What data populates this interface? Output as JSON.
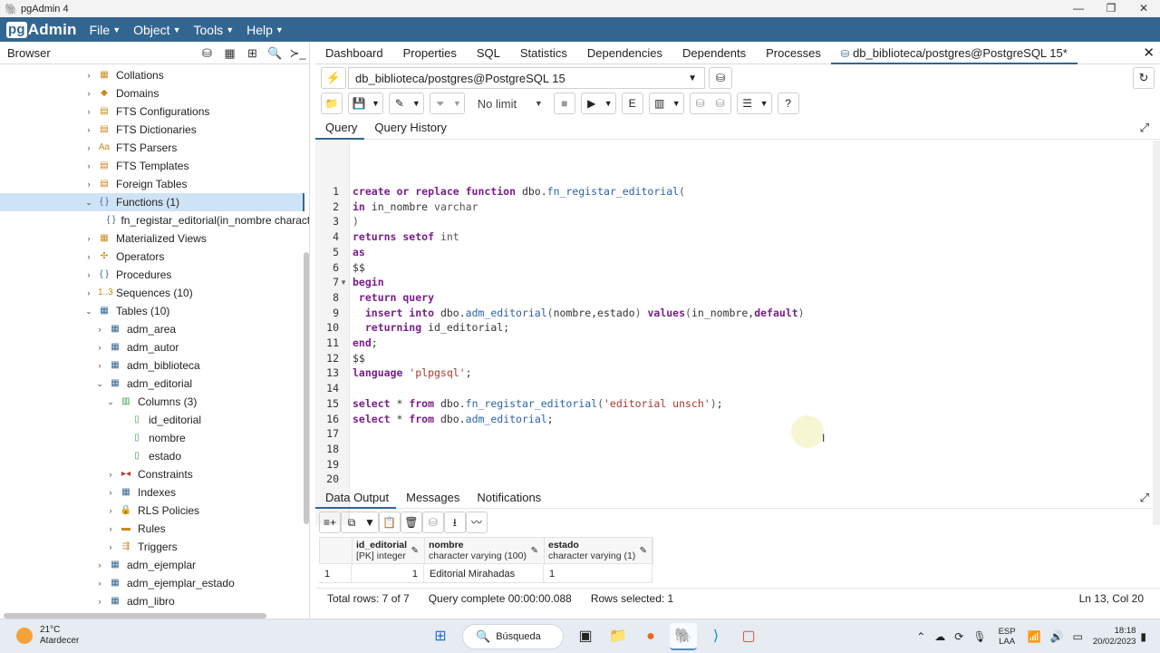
{
  "window": {
    "title": "pgAdmin 4",
    "minimize": "—",
    "maximize": "❐",
    "close": "✕"
  },
  "menubar": {
    "logo_pg": "pg",
    "logo_text": "Admin",
    "items": [
      {
        "label": "File"
      },
      {
        "label": "Object"
      },
      {
        "label": "Tools"
      },
      {
        "label": "Help"
      }
    ]
  },
  "browser": {
    "title": "Browser",
    "tree": [
      {
        "label": "Collations",
        "level": 1,
        "icon": "collation-icon",
        "glyph": "▦",
        "toggle": "›"
      },
      {
        "label": "Domains",
        "level": 1,
        "icon": "domain-icon",
        "glyph": "◆",
        "toggle": "›"
      },
      {
        "label": "FTS Configurations",
        "level": 1,
        "icon": "fts-config-icon",
        "glyph": "▤",
        "toggle": "›"
      },
      {
        "label": "FTS Dictionaries",
        "level": 1,
        "icon": "fts-dictionary-icon",
        "glyph": "▤",
        "toggle": "›"
      },
      {
        "label": "FTS Parsers",
        "level": 1,
        "icon": "fts-parser-icon",
        "glyph": "Aa",
        "toggle": "›"
      },
      {
        "label": "FTS Templates",
        "level": 1,
        "icon": "fts-template-icon",
        "glyph": "▤",
        "toggle": "›"
      },
      {
        "label": "Foreign Tables",
        "level": 1,
        "icon": "foreign-table-icon",
        "glyph": "▤",
        "toggle": "›"
      },
      {
        "label": "Functions (1)",
        "level": 1,
        "icon": "functions-icon",
        "glyph": "{ }",
        "toggle": "⌄",
        "selected": true
      },
      {
        "label": "fn_registar_editorial(in_nombre character",
        "level": 2,
        "icon": "function-icon",
        "glyph": "{ }",
        "toggle": ""
      },
      {
        "label": "Materialized Views",
        "level": 1,
        "icon": "materialized-view-icon",
        "glyph": "▦",
        "toggle": "›"
      },
      {
        "label": "Operators",
        "level": 1,
        "icon": "operator-icon",
        "glyph": "✣",
        "toggle": "›"
      },
      {
        "label": "Procedures",
        "level": 1,
        "icon": "procedure-icon",
        "glyph": "{ }",
        "toggle": "›"
      },
      {
        "label": "Sequences (10)",
        "level": 1,
        "icon": "sequence-icon",
        "glyph": "1..3",
        "toggle": "›"
      },
      {
        "label": "Tables (10)",
        "level": 1,
        "icon": "tables-icon",
        "glyph": "▦",
        "toggle": "⌄"
      },
      {
        "label": "adm_area",
        "level": 2,
        "icon": "table-icon",
        "glyph": "▦",
        "toggle": "›"
      },
      {
        "label": "adm_autor",
        "level": 2,
        "icon": "table-icon",
        "glyph": "▦",
        "toggle": "›"
      },
      {
        "label": "adm_biblioteca",
        "level": 2,
        "icon": "table-icon",
        "glyph": "▦",
        "toggle": "›"
      },
      {
        "label": "adm_editorial",
        "level": 2,
        "icon": "table-icon",
        "glyph": "▦",
        "toggle": "⌄"
      },
      {
        "label": "Columns (3)",
        "level": 3,
        "icon": "columns-icon",
        "glyph": "▥",
        "toggle": "⌄"
      },
      {
        "label": "id_editorial",
        "level": 4,
        "icon": "column-icon",
        "glyph": "▯",
        "toggle": ""
      },
      {
        "label": "nombre",
        "level": 4,
        "icon": "column-icon",
        "glyph": "▯",
        "toggle": ""
      },
      {
        "label": "estado",
        "level": 4,
        "icon": "column-icon",
        "glyph": "▯",
        "toggle": ""
      },
      {
        "label": "Constraints",
        "level": 3,
        "icon": "constraint-icon",
        "glyph": "▸◂",
        "toggle": "›"
      },
      {
        "label": "Indexes",
        "level": 3,
        "icon": "index-icon",
        "glyph": "▦",
        "toggle": "›"
      },
      {
        "label": "RLS Policies",
        "level": 3,
        "icon": "rls-policy-icon",
        "glyph": "🔒",
        "toggle": "›"
      },
      {
        "label": "Rules",
        "level": 3,
        "icon": "rule-icon",
        "glyph": "▬",
        "toggle": "›"
      },
      {
        "label": "Triggers",
        "level": 3,
        "icon": "trigger-icon",
        "glyph": "⇶",
        "toggle": "›"
      },
      {
        "label": "adm_ejemplar",
        "level": 2,
        "icon": "table-icon",
        "glyph": "▦",
        "toggle": "›"
      },
      {
        "label": "adm_ejemplar_estado",
        "level": 2,
        "icon": "table-icon",
        "glyph": "▦",
        "toggle": "›"
      },
      {
        "label": "adm_libro",
        "level": 2,
        "icon": "table-icon",
        "glyph": "▦",
        "toggle": "›"
      }
    ]
  },
  "main_tabs": [
    {
      "label": "Dashboard"
    },
    {
      "label": "Properties"
    },
    {
      "label": "SQL"
    },
    {
      "label": "Statistics"
    },
    {
      "label": "Dependencies"
    },
    {
      "label": "Dependents"
    },
    {
      "label": "Processes"
    },
    {
      "label": "db_biblioteca/postgres@PostgreSQL 15*",
      "active": true
    }
  ],
  "connection": {
    "value": "db_biblioteca/postgres@PostgreSQL 15"
  },
  "toolbar": {
    "limit": "No limit"
  },
  "query_tabs": [
    {
      "label": "Query",
      "active": true
    },
    {
      "label": "Query History"
    }
  ],
  "editor": {
    "lines": [
      [
        [
          "kw",
          "create or replace function "
        ],
        [
          "",
          "dbo."
        ],
        [
          "fnc",
          "fn_registar_editorial"
        ],
        [
          "ty",
          "("
        ]
      ],
      [
        [
          "kw",
          "in "
        ],
        [
          "",
          "in_nombre "
        ],
        [
          "ty",
          "varchar"
        ]
      ],
      [
        [
          "ty",
          ")"
        ]
      ],
      [
        [
          "kw",
          "returns setof "
        ],
        [
          "ty",
          "int"
        ]
      ],
      [
        [
          "kw",
          "as"
        ]
      ],
      [
        [
          "",
          "$$"
        ]
      ],
      [
        [
          "kw",
          "begin"
        ]
      ],
      [
        [
          "kw",
          " return query"
        ]
      ],
      [
        [
          "kw",
          "  insert into "
        ],
        [
          "",
          "dbo."
        ],
        [
          "fnc",
          "adm_editorial"
        ],
        [
          "ty",
          "("
        ],
        [
          "",
          "nombre,estado"
        ],
        [
          "ty",
          ") "
        ],
        [
          "kw",
          "values"
        ],
        [
          "ty",
          "("
        ],
        [
          "",
          "in_nombre,"
        ],
        [
          "kw",
          "default"
        ],
        [
          "ty",
          ")"
        ]
      ],
      [
        [
          "kw",
          "  returning "
        ],
        [
          "",
          "id_editorial;"
        ]
      ],
      [
        [
          "kw",
          "end"
        ],
        [
          "",
          ";"
        ]
      ],
      [
        [
          "",
          "$$"
        ]
      ],
      [
        [
          "kw",
          "language "
        ],
        [
          "str",
          "'plpgsql'"
        ],
        [
          "",
          ";"
        ]
      ],
      [],
      [
        [
          "kw",
          "select "
        ],
        [
          "",
          "* "
        ],
        [
          "kw",
          "from "
        ],
        [
          "",
          "dbo."
        ],
        [
          "fnc",
          "fn_registar_editorial"
        ],
        [
          "ty",
          "("
        ],
        [
          "str",
          "'editorial unsch'"
        ],
        [
          "ty",
          ")"
        ],
        [
          "",
          ";"
        ]
      ],
      [
        [
          "kw",
          "select "
        ],
        [
          "",
          "* "
        ],
        [
          "kw",
          "from "
        ],
        [
          "",
          "dbo."
        ],
        [
          "fnc",
          "adm_editorial"
        ],
        [
          "",
          ";"
        ]
      ],
      [],
      [],
      [],
      []
    ],
    "line_numbers": [
      "1",
      "2",
      "3",
      "4",
      "5",
      "6",
      "7",
      "8",
      "9",
      "10",
      "11",
      "12",
      "13",
      "14",
      "15",
      "16",
      "17",
      "18",
      "19",
      "20"
    ]
  },
  "result_tabs": [
    {
      "label": "Data Output",
      "active": true
    },
    {
      "label": "Messages"
    },
    {
      "label": "Notifications"
    }
  ],
  "grid": {
    "columns": [
      {
        "name": "id_editorial",
        "type": "[PK] integer"
      },
      {
        "name": "nombre",
        "type": "character varying (100)"
      },
      {
        "name": "estado",
        "type": "character varying (1)"
      }
    ],
    "rows": [
      {
        "num": "1",
        "cells": [
          "1",
          "Editorial Mirahadas",
          "1"
        ]
      }
    ]
  },
  "status": {
    "total_rows": "Total rows: 7 of 7",
    "query_complete": "Query complete 00:00:00.088",
    "rows_selected": "Rows selected: 1",
    "cursor_pos": "Ln 13, Col 20"
  },
  "taskbar": {
    "temperature": "21°C",
    "weather": "Atardecer",
    "search_label": "Búsqueda",
    "lang_top": "ESP",
    "lang_bottom": "LAA",
    "time": "18:18",
    "date": "20/02/2023"
  }
}
